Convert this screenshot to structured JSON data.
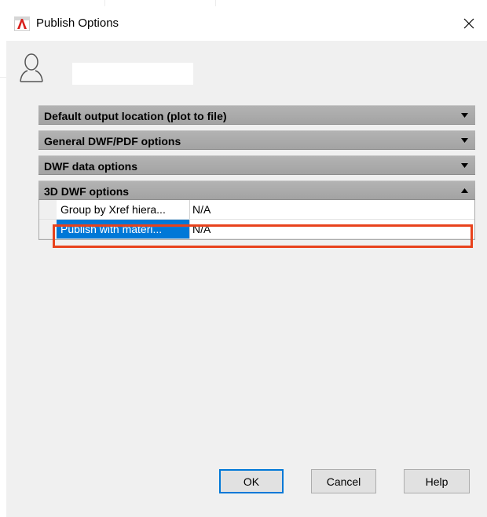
{
  "window": {
    "title": "Publish Options"
  },
  "user": {
    "name_value": ""
  },
  "sections": {
    "output_location": "Default output location (plot to file)",
    "general": "General DWF/PDF options",
    "dwf_data": "DWF data options",
    "dwf_3d": "3D DWF options"
  },
  "rows": [
    {
      "name": "Group by Xref hiera...",
      "value": "N/A"
    },
    {
      "name": "Publish with materi...",
      "value": "N/A"
    }
  ],
  "buttons": {
    "ok": "OK",
    "cancel": "Cancel",
    "help": "Help"
  },
  "colors": {
    "selection": "#0078d7",
    "highlight_box": "#e8421c",
    "section_header": "#a9a9a9"
  }
}
